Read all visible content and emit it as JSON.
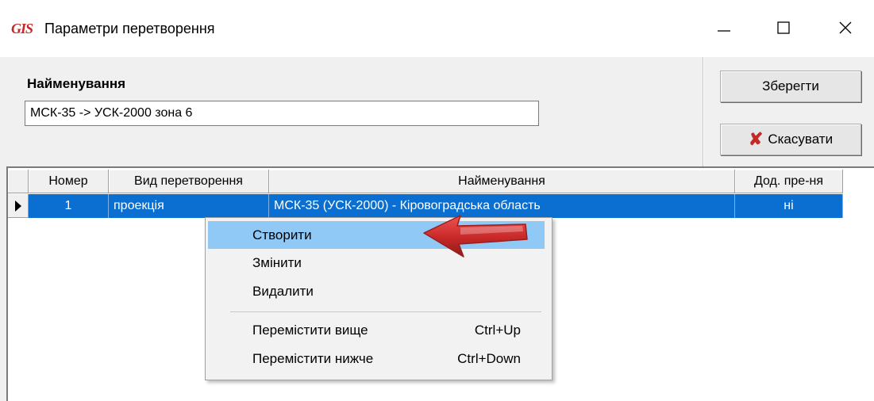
{
  "window": {
    "title": "Параметри перетворення",
    "logo_text": "GIS",
    "minimize_icon": "minimize-icon",
    "maximize_icon": "maximize-icon",
    "close_icon": "close-icon"
  },
  "form": {
    "name_label": "Найменування",
    "name_value": "МСК-35 -> УСК-2000 зона 6",
    "save_label": "Зберегти",
    "cancel_label": "Скасувати",
    "cancel_icon": "red-x-icon"
  },
  "grid": {
    "columns": [
      "Номер",
      "Вид перетворення",
      "Найменування",
      "Дод. пре-ня"
    ],
    "rows": [
      {
        "number": "1",
        "type": "проекція",
        "name": "МСК-35 (УСК-2000) - Кіровоградська область",
        "additional": "ні",
        "selected": true
      }
    ]
  },
  "context_menu": {
    "items": [
      {
        "label": "Створити",
        "shortcut": "",
        "highlighted": true
      },
      {
        "label": "Змінити",
        "shortcut": ""
      },
      {
        "label": "Видалити",
        "shortcut": ""
      },
      {
        "label": "Перемістити вище",
        "shortcut": "Ctrl+Up"
      },
      {
        "label": "Перемістити нижче",
        "shortcut": "Ctrl+Down"
      }
    ]
  },
  "colors": {
    "selection": "#0a6fd1",
    "menu_highlight": "#90c8f6",
    "annotation_arrow": "#d32f2f"
  }
}
